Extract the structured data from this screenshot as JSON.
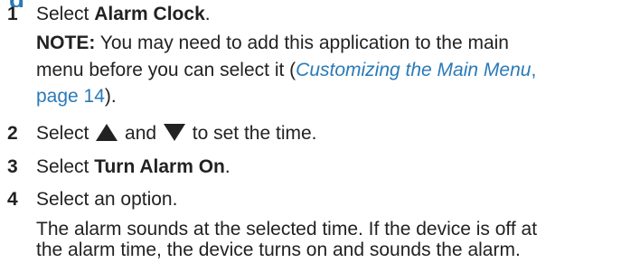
{
  "heading": {
    "text": "g"
  },
  "steps": [
    {
      "number": "1",
      "prefix": "Select ",
      "bold": "Alarm Clock",
      "suffix": "."
    },
    {
      "number": "2",
      "prefix": "Select ",
      "middle": " and ",
      "suffix": " to set the time.",
      "icons": [
        "up-arrow-icon",
        "down-arrow-icon"
      ]
    },
    {
      "number": "3",
      "prefix": "Select ",
      "bold": "Turn Alarm On",
      "suffix": "."
    },
    {
      "number": "4",
      "text": "Select an option."
    }
  ],
  "note": {
    "label": "NOTE:",
    "line1": " You may need to add this application to the main",
    "line2_prefix": "menu before you can select it (",
    "link_text": "Customizing the Main Menu",
    "line2_suffix": ",",
    "link_page": "page 14",
    "line3_suffix": ")."
  },
  "result": {
    "line1": "The alarm sounds at the selected time. If the device is off at",
    "line2": "the alarm time, the device turns on and sounds the alarm."
  },
  "colors": {
    "text": "#222222",
    "link": "#2a7ab8"
  }
}
